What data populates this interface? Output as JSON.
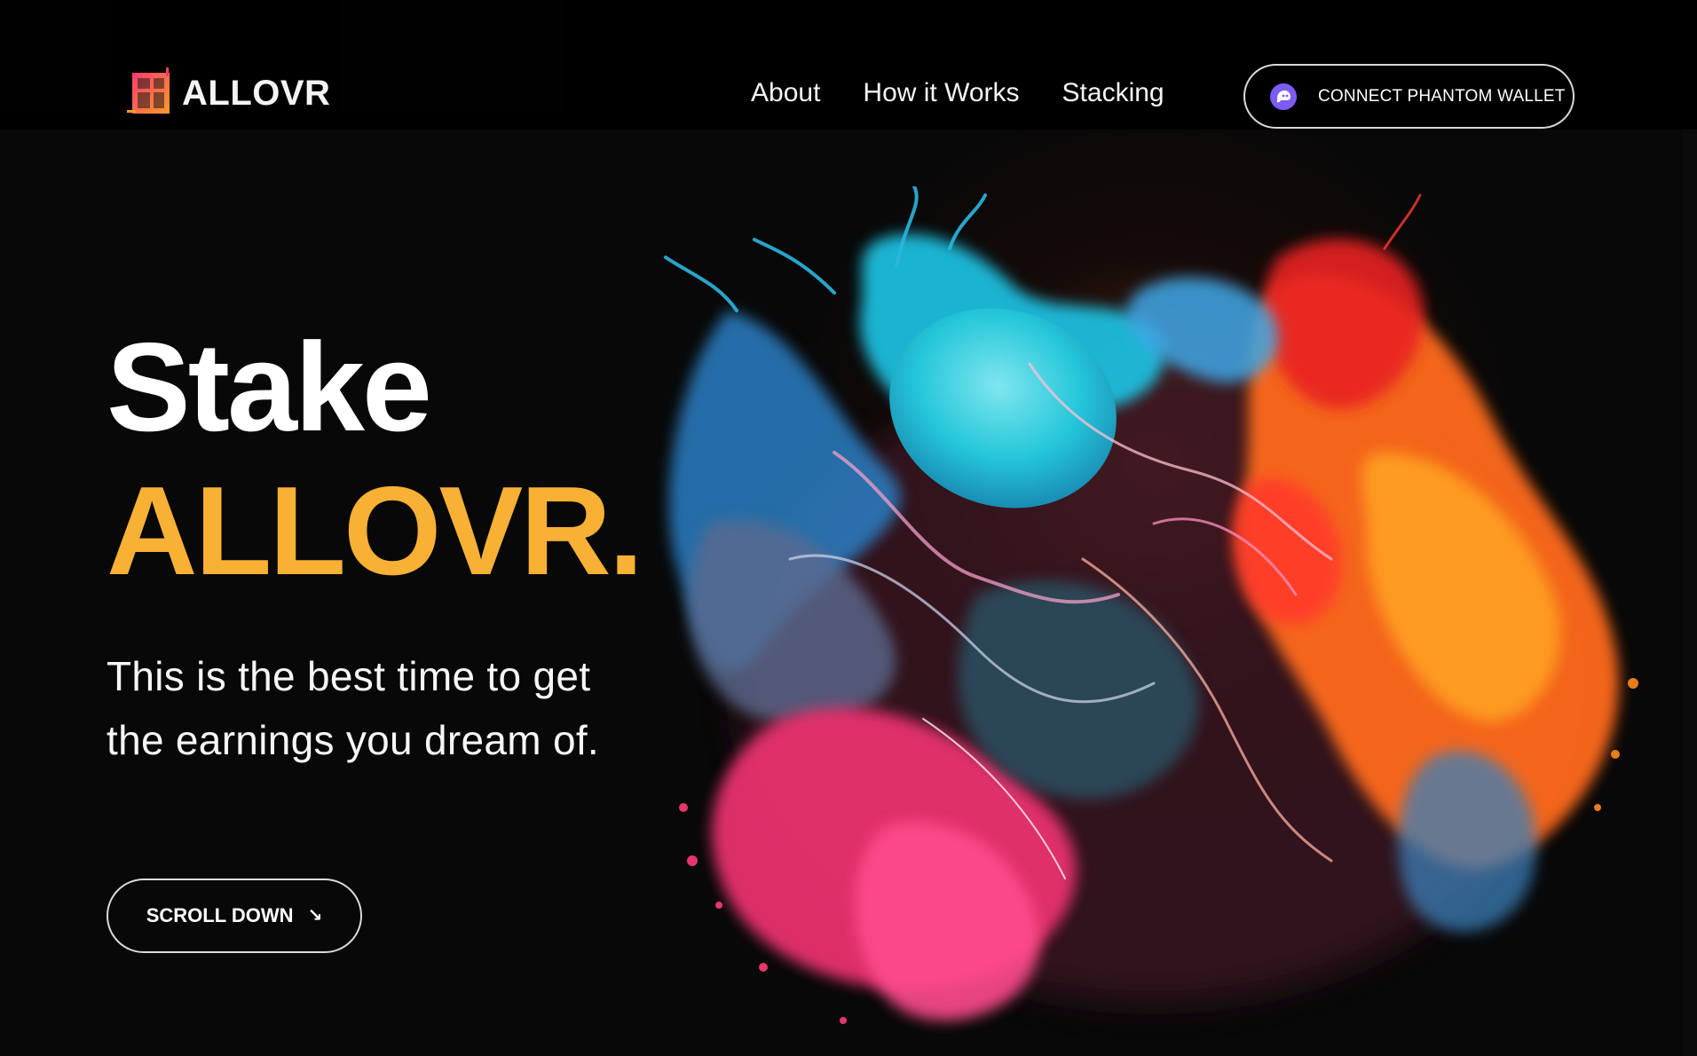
{
  "header": {
    "logo_text": "ALLOVR",
    "nav": [
      {
        "label": "About"
      },
      {
        "label": "How it Works"
      },
      {
        "label": "Stacking"
      }
    ],
    "wallet_button": {
      "label": "CONNECT PHANTOM WALLET",
      "icon": "phantom-icon"
    }
  },
  "hero": {
    "title_line1": "Stake",
    "title_line2": "ALLOVR.",
    "subtitle": "This is the best time to get the earnings you dream of.",
    "scroll_button": {
      "label": "SCROLL DOWN",
      "icon": "arrow-down-right-icon",
      "glyph": "↘"
    }
  },
  "colors": {
    "background": "#080808",
    "accent": "#f8b035",
    "glow": "#ec2880",
    "wallet_icon": "#7c5cf0"
  }
}
